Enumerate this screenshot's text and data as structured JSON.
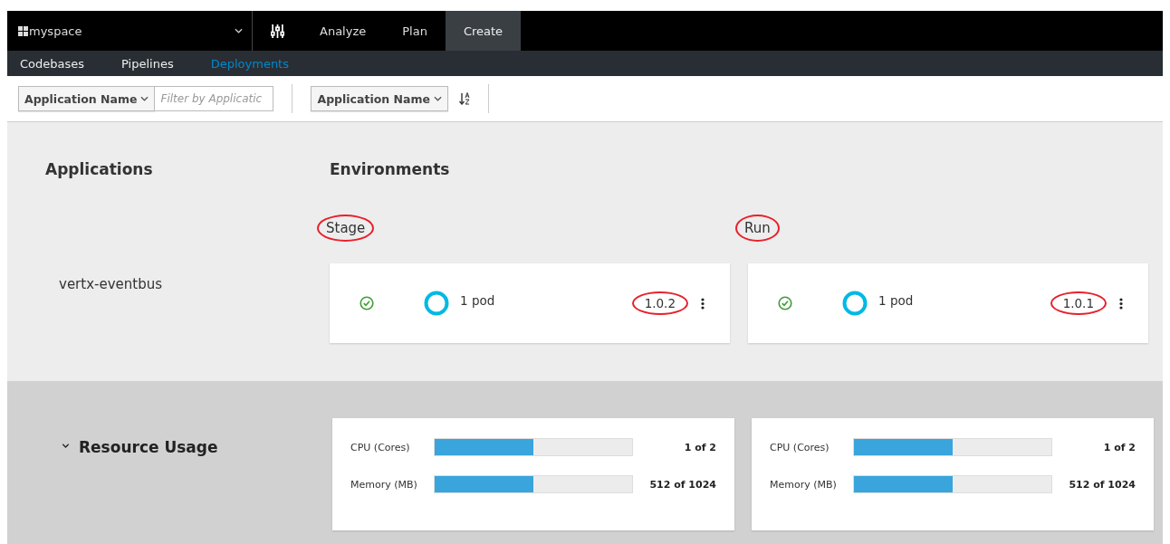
{
  "top_nav": {
    "space": "myspace",
    "items": [
      {
        "label": "Analyze",
        "selected": false
      },
      {
        "label": "Plan",
        "selected": false
      },
      {
        "label": "Create",
        "selected": true
      }
    ]
  },
  "sub_nav": [
    {
      "label": "Codebases",
      "selected": false
    },
    {
      "label": "Pipelines",
      "selected": false
    },
    {
      "label": "Deployments",
      "selected": true
    }
  ],
  "toolbar": {
    "filter_field": "Application Name",
    "filter_placeholder": "Filter by Applicatic",
    "sort_field": "Application Name"
  },
  "headings": {
    "applications": "Applications",
    "environments": "Environments"
  },
  "environments": [
    {
      "name": "Stage",
      "circled": true
    },
    {
      "name": "Run",
      "circled": true
    }
  ],
  "applications": [
    {
      "name": "vertx-eventbus",
      "deployments": [
        {
          "healthy": true,
          "pods": "1 pod",
          "version": "1.0.2",
          "version_circled": true
        },
        {
          "healthy": true,
          "pods": "1 pod",
          "version": "1.0.1",
          "version_circled": true
        }
      ]
    }
  ],
  "resource_usage": {
    "title": "Resource Usage",
    "expanded": true,
    "cards": [
      {
        "metrics": [
          {
            "label": "CPU (Cores)",
            "level": 0.5,
            "reading": "1 of 2"
          },
          {
            "label": "Memory (MB)",
            "level": 0.5,
            "reading": "512 of 1024"
          }
        ]
      },
      {
        "metrics": [
          {
            "label": "CPU (Cores)",
            "level": 0.5,
            "reading": "1 of 2"
          },
          {
            "label": "Memory (MB)",
            "level": 0.5,
            "reading": "512 of 1024"
          }
        ]
      }
    ]
  }
}
